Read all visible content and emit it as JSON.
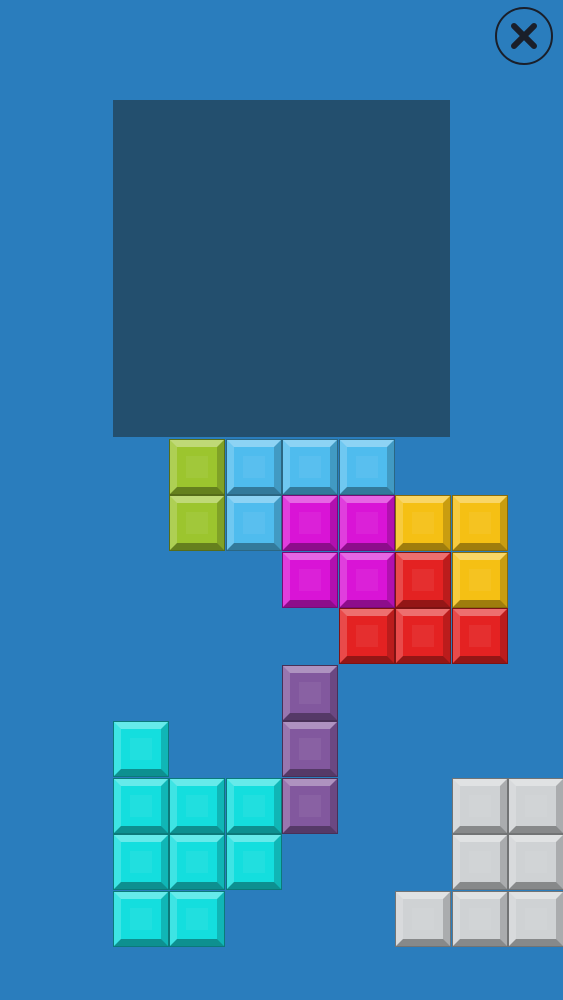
{
  "game": {
    "pieces": [
      {
        "name": "piece-green-domino",
        "color": "#9cc52e",
        "cells": [
          [
            3,
            7
          ],
          [
            3,
            8
          ]
        ],
        "interactable": false
      },
      {
        "name": "piece-lightblue-j",
        "color": "#4fbcee",
        "cells": [
          [
            4,
            7
          ],
          [
            5,
            7
          ],
          [
            6,
            7
          ],
          [
            4,
            8
          ]
        ],
        "interactable": false
      },
      {
        "name": "piece-magenta-square",
        "color": "#d914d6",
        "cells": [
          [
            5,
            8
          ],
          [
            6,
            8
          ],
          [
            5,
            9
          ],
          [
            6,
            9
          ]
        ],
        "interactable": false
      },
      {
        "name": "piece-yellow-l",
        "color": "#f5c014",
        "cells": [
          [
            7,
            8
          ],
          [
            8,
            8
          ],
          [
            8,
            9
          ]
        ],
        "interactable": false
      },
      {
        "name": "piece-red-t",
        "color": "#e42222",
        "cells": [
          [
            7,
            9
          ],
          [
            6,
            10
          ],
          [
            7,
            10
          ],
          [
            8,
            10
          ]
        ],
        "interactable": false
      },
      {
        "name": "piece-purple-i",
        "color": "#82589e",
        "cells": [
          [
            5,
            11
          ],
          [
            5,
            12
          ],
          [
            5,
            13
          ]
        ],
        "interactable": true
      },
      {
        "name": "piece-cyan-shape",
        "color": "#14dede",
        "cells": [
          [
            2,
            12
          ],
          [
            2,
            13
          ],
          [
            3,
            13
          ],
          [
            4,
            13
          ],
          [
            2,
            14
          ],
          [
            3,
            14
          ],
          [
            4,
            14
          ],
          [
            2,
            15
          ],
          [
            3,
            15
          ]
        ],
        "interactable": true
      },
      {
        "name": "piece-gray-shape",
        "color": "#cfd2d4",
        "cells": [
          [
            8,
            13
          ],
          [
            9,
            13
          ],
          [
            8,
            14
          ],
          [
            9,
            14
          ],
          [
            7,
            15
          ],
          [
            8,
            15
          ],
          [
            9,
            15
          ]
        ],
        "interactable": true
      }
    ]
  },
  "icons": {
    "close": "close-icon"
  }
}
